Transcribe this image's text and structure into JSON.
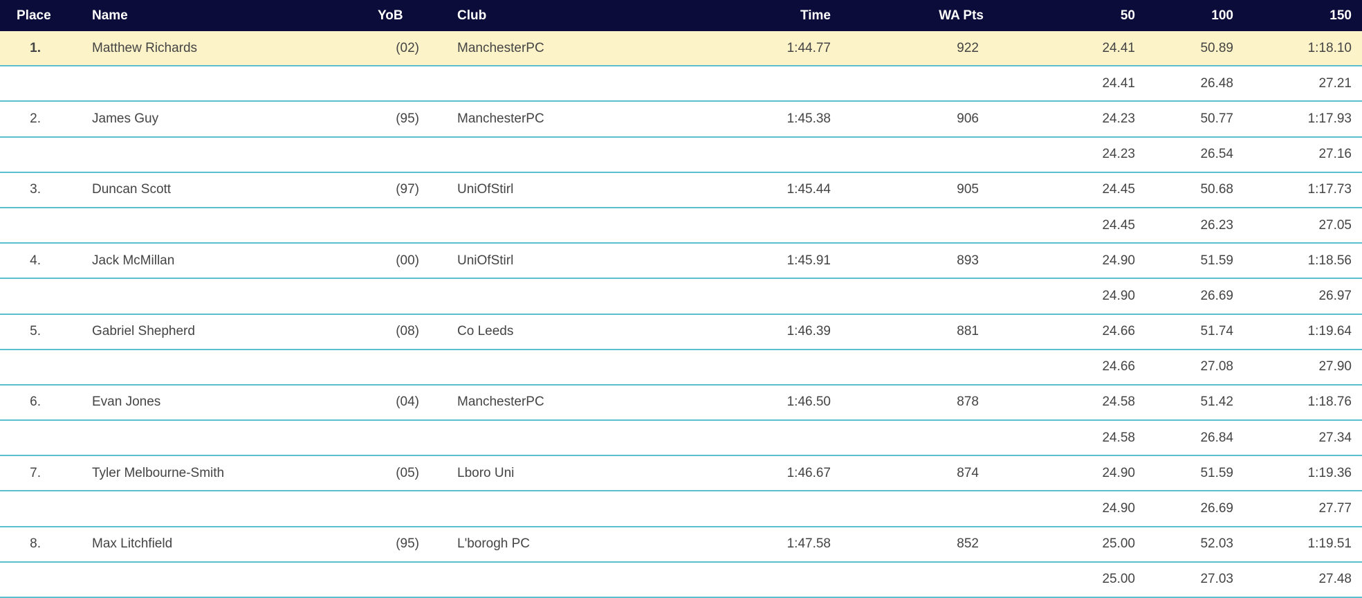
{
  "header": {
    "place": "Place",
    "name": "Name",
    "yob": "YoB",
    "club": "Club",
    "time": "Time",
    "wapts": "WA Pts",
    "s50": "50",
    "s100": "100",
    "s150": "150"
  },
  "colors": {
    "header_bg": "#0b0c3a",
    "highlight_bg": "#fdf3c8",
    "divider": "#5bbfd0"
  },
  "results": [
    {
      "place": "1.",
      "name": "Matthew Richards",
      "yob": "(02)",
      "club": "ManchesterPC",
      "time": "1:44.77",
      "wapts": "922",
      "cum": [
        "24.41",
        "50.89",
        "1:18.10"
      ],
      "laps": [
        "24.41",
        "26.48",
        "27.21"
      ]
    },
    {
      "place": "2.",
      "name": "James Guy",
      "yob": "(95)",
      "club": "ManchesterPC",
      "time": "1:45.38",
      "wapts": "906",
      "cum": [
        "24.23",
        "50.77",
        "1:17.93"
      ],
      "laps": [
        "24.23",
        "26.54",
        "27.16"
      ]
    },
    {
      "place": "3.",
      "name": "Duncan Scott",
      "yob": "(97)",
      "club": "UniOfStirl",
      "time": "1:45.44",
      "wapts": "905",
      "cum": [
        "24.45",
        "50.68",
        "1:17.73"
      ],
      "laps": [
        "24.45",
        "26.23",
        "27.05"
      ]
    },
    {
      "place": "4.",
      "name": "Jack McMillan",
      "yob": "(00)",
      "club": "UniOfStirl",
      "time": "1:45.91",
      "wapts": "893",
      "cum": [
        "24.90",
        "51.59",
        "1:18.56"
      ],
      "laps": [
        "24.90",
        "26.69",
        "26.97"
      ]
    },
    {
      "place": "5.",
      "name": "Gabriel Shepherd",
      "yob": "(08)",
      "club": "Co Leeds",
      "time": "1:46.39",
      "wapts": "881",
      "cum": [
        "24.66",
        "51.74",
        "1:19.64"
      ],
      "laps": [
        "24.66",
        "27.08",
        "27.90"
      ]
    },
    {
      "place": "6.",
      "name": "Evan Jones",
      "yob": "(04)",
      "club": "ManchesterPC",
      "time": "1:46.50",
      "wapts": "878",
      "cum": [
        "24.58",
        "51.42",
        "1:18.76"
      ],
      "laps": [
        "24.58",
        "26.84",
        "27.34"
      ]
    },
    {
      "place": "7.",
      "name": "Tyler Melbourne-Smith",
      "yob": "(05)",
      "club": "Lboro Uni",
      "time": "1:46.67",
      "wapts": "874",
      "cum": [
        "24.90",
        "51.59",
        "1:19.36"
      ],
      "laps": [
        "24.90",
        "26.69",
        "27.77"
      ]
    },
    {
      "place": "8.",
      "name": "Max Litchfield",
      "yob": "(95)",
      "club": "L'borogh PC",
      "time": "1:47.58",
      "wapts": "852",
      "cum": [
        "25.00",
        "52.03",
        "1:19.51"
      ],
      "laps": [
        "25.00",
        "27.03",
        "27.48"
      ]
    }
  ]
}
